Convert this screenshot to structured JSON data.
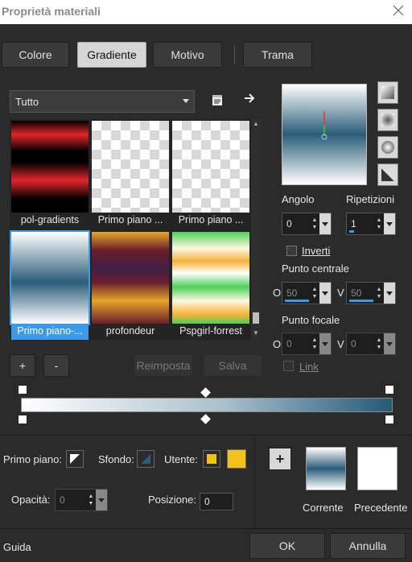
{
  "window": {
    "title": "Proprietà materiali"
  },
  "tabs": [
    {
      "label": "Colore"
    },
    {
      "label": "Gradiente"
    },
    {
      "label": "Motivo"
    },
    {
      "label": "Trama"
    }
  ],
  "active_tab": "Gradiente",
  "category_select": {
    "value": "Tutto"
  },
  "gallery": {
    "items": [
      {
        "label": "pol-gradients"
      },
      {
        "label": "Primo piano ..."
      },
      {
        "label": "Primo piano ..."
      },
      {
        "label": "Primo piano-..."
      },
      {
        "label": "profondeur"
      },
      {
        "label": "Pspgirl-forrest"
      }
    ],
    "selected_index": 3
  },
  "gallery_buttons": {
    "add": "+",
    "remove": "-",
    "reset": "Reimposta",
    "save": "Salva"
  },
  "angle": {
    "label": "Angolo",
    "value": "0"
  },
  "repeats": {
    "label": "Ripetizioni",
    "value": "1"
  },
  "invert": {
    "label": "Inverti",
    "checked": false
  },
  "center_point": {
    "label": "Punto centrale",
    "h_label": "O",
    "h_value": "50",
    "v_label": "V",
    "v_value": "50"
  },
  "focal_point": {
    "label": "Punto focale",
    "h_label": "O",
    "h_value": "0",
    "v_label": "V",
    "v_value": "0"
  },
  "link": {
    "label": "Link",
    "checked": false
  },
  "stops": {
    "foreground_label": "Primo piano:",
    "background_label": "Sfondo:",
    "user_label": "Utente:",
    "user_color": "#f2c21b",
    "opacity_label": "Opacità:",
    "opacity_value": "0",
    "position_label": "Posizione:",
    "position_value": "0"
  },
  "swatches": {
    "current_label": "Corrente",
    "previous_label": "Precedente",
    "add_symbol": "+"
  },
  "footer": {
    "help": "Guida",
    "ok": "OK",
    "cancel": "Annulla"
  },
  "colors": {
    "accent": "#3d9ae8",
    "gradient_dark": "#245a77",
    "gradient_light": "#ffffff"
  }
}
